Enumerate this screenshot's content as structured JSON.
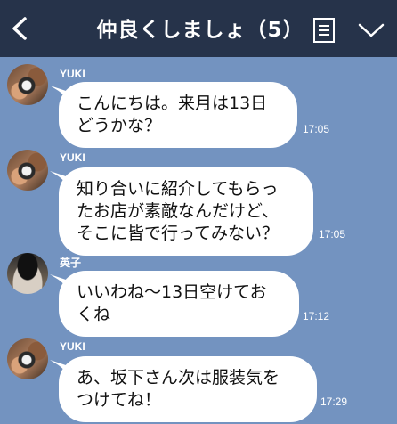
{
  "header": {
    "title": "仲良くしましょ（5）"
  },
  "messages": [
    {
      "sender": "YUKI",
      "avatar": "yuki",
      "lines": [
        "こんにちは。来月は13日",
        "どうかな？"
      ],
      "time": "17:05"
    },
    {
      "sender": "YUKI",
      "avatar": "yuki",
      "lines": [
        "知り合いに紹介してもらっ",
        "たお店が素敵なんだけど、",
        "そこに皆で行ってみない？"
      ],
      "time": "17:05"
    },
    {
      "sender": "英子",
      "avatar": "eiko",
      "lines": [
        "いいわね〜13日空けてお",
        "くね"
      ],
      "time": "17:12"
    },
    {
      "sender": "YUKI",
      "avatar": "yuki",
      "lines": [
        "あ、坂下さん次は服装気を",
        "つけてね！"
      ],
      "time": "17:29"
    }
  ],
  "colors": {
    "header_bg": "#26334a",
    "chat_bg": "#7393c0",
    "bubble_bg": "#ffffff"
  },
  "icons": [
    "chevron-left-icon",
    "note-icon",
    "chevron-down-icon"
  ]
}
